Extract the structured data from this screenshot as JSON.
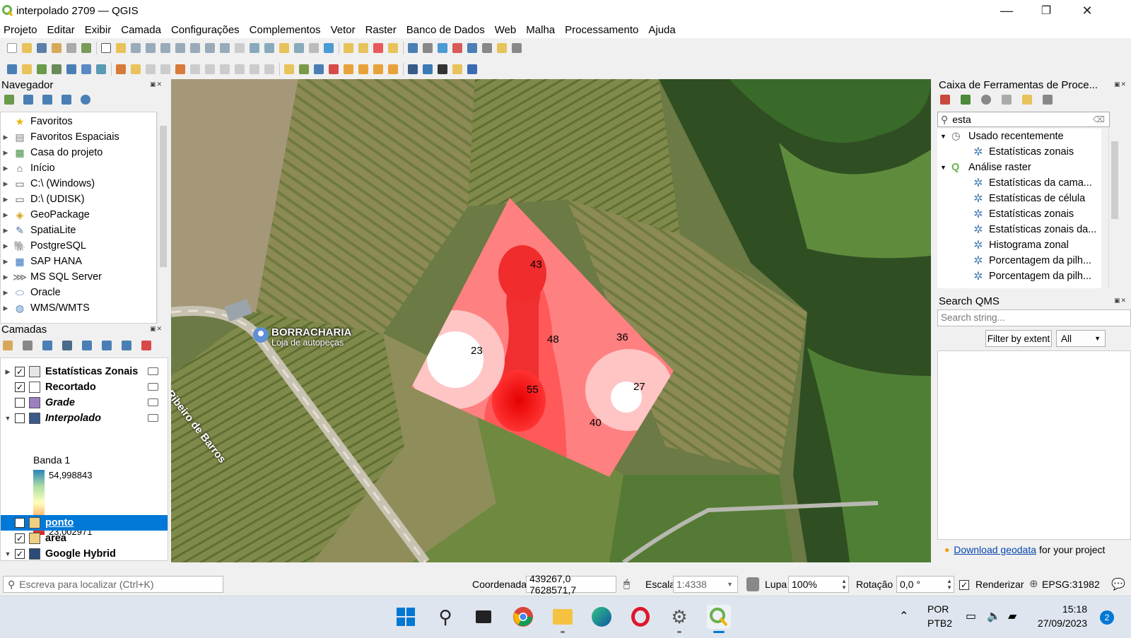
{
  "window": {
    "title": "interpolado 2709 — QGIS",
    "controls": {
      "minimize": "—",
      "restore": "❐",
      "close": "✕"
    }
  },
  "menubar": [
    "Projeto",
    "Editar",
    "Exibir",
    "Camada",
    "Configurações",
    "Complementos",
    "Vetor",
    "Raster",
    "Banco de Dados",
    "Web",
    "Malha",
    "Processamento",
    "Ajuda"
  ],
  "browser_panel": {
    "title": "Navegador",
    "items": [
      {
        "label": "Favoritos",
        "icon": "star-icon",
        "glyph": "★",
        "color": "#e8b400"
      },
      {
        "label": "Favoritos Espaciais",
        "icon": "spatial-bookmark-icon",
        "glyph": "▤",
        "color": "#777"
      },
      {
        "label": "Casa do projeto",
        "icon": "project-home-icon",
        "glyph": "▦",
        "color": "#3a8a3a"
      },
      {
        "label": "Início",
        "icon": "home-icon",
        "glyph": "⌂",
        "color": "#555"
      },
      {
        "label": "C:\\ (Windows)",
        "icon": "drive-icon",
        "glyph": "▭",
        "color": "#555"
      },
      {
        "label": "D:\\ (UDISK)",
        "icon": "drive-icon",
        "glyph": "▭",
        "color": "#555"
      },
      {
        "label": "GeoPackage",
        "icon": "geopackage-icon",
        "glyph": "◈",
        "color": "#d4a017"
      },
      {
        "label": "SpatiaLite",
        "icon": "spatialite-icon",
        "glyph": "✎",
        "color": "#4a6fa5"
      },
      {
        "label": "PostgreSQL",
        "icon": "postgresql-icon",
        "glyph": "🐘",
        "color": "#336791"
      },
      {
        "label": "SAP HANA",
        "icon": "sap-hana-icon",
        "glyph": "▦",
        "color": "#2a6ebb"
      },
      {
        "label": "MS SQL Server",
        "icon": "mssql-icon",
        "glyph": "⋙",
        "color": "#666"
      },
      {
        "label": "Oracle",
        "icon": "oracle-icon",
        "glyph": "⬭",
        "color": "#4a7fb5"
      },
      {
        "label": "WMS/WMTS",
        "icon": "wms-icon",
        "glyph": "◍",
        "color": "#4a7fb5"
      }
    ]
  },
  "layers_panel": {
    "title": "Camadas",
    "layers": [
      {
        "label": "Estatísticas Zonais",
        "checked": true,
        "bold": true,
        "italic": false,
        "expand": "▶",
        "icon": "polygon-layer-icon",
        "icolor": "#e5e5e5",
        "indicator": true
      },
      {
        "label": "Recortado",
        "checked": true,
        "bold": true,
        "italic": false,
        "expand": "",
        "icon": "polygon-outline-icon",
        "icolor": "#ffffff",
        "indicator": true
      },
      {
        "label": "Grade",
        "checked": false,
        "bold": true,
        "italic": true,
        "expand": "",
        "icon": "polygon-fill-icon",
        "icolor": "#9b7fc1",
        "indicator": true
      },
      {
        "label": "Interpolado",
        "checked": false,
        "bold": true,
        "italic": true,
        "expand": "▼",
        "icon": "raster-layer-icon",
        "icolor": "#3a5a8a",
        "indicator": true
      }
    ],
    "legend": {
      "band": "Banda 1",
      "max": "54,998843",
      "min": "23,002971"
    },
    "layers_bottom": [
      {
        "label": "ponto",
        "checked": true,
        "selected": true,
        "expand": "",
        "icon": "point-layer-icon"
      },
      {
        "label": "area",
        "checked": true,
        "selected": false,
        "expand": "",
        "icon": "polygon-edit-icon"
      },
      {
        "label": "Google Hybrid",
        "checked": true,
        "selected": false,
        "expand": "▼",
        "icon": "xyz-tile-icon"
      }
    ]
  },
  "map": {
    "poi": {
      "name": "BORRACHARIA",
      "sub": "Loja de autopeças"
    },
    "road_name": "ão Ribeiro de Barros",
    "point_labels": [
      {
        "text": "43"
      },
      {
        "text": "48"
      },
      {
        "text": "36"
      },
      {
        "text": "23"
      },
      {
        "text": "55"
      },
      {
        "text": "27"
      },
      {
        "text": "40"
      }
    ]
  },
  "processing_panel": {
    "title": "Caixa de Ferramentas de Proce...",
    "search_value": "esta",
    "groups": [
      {
        "label": "Usado recentemente",
        "icon": "clock-icon",
        "items": [
          "Estatísticas zonais"
        ]
      },
      {
        "label": "Análise raster",
        "icon": "qgis-icon",
        "items": [
          "Estatísticas da cama...",
          "Estatísticas de célula",
          "Estatísticas zonais",
          "Estatísticas zonais da...",
          "Histograma zonal",
          "Porcentagem da pilh...",
          "Porcentagem da pilh..."
        ]
      }
    ]
  },
  "qms_panel": {
    "title": "Search QMS",
    "placeholder": "Search string...",
    "filter_button": "Filter by extent",
    "filter_select": "All",
    "footer_link": "Download geodata",
    "footer_text": "for your project"
  },
  "statusbar": {
    "locator_placeholder": "Escreva para localizar (Ctrl+K)",
    "coord_label": "Coordenada",
    "coord_value": "439267,0 7628571,7",
    "scale_label": "Escala",
    "scale_value": "1:4338",
    "magnifier_label": "Lupa",
    "magnifier_value": "100%",
    "rotation_label": "Rotação",
    "rotation_value": "0,0 °",
    "render_label": "Renderizar",
    "crs": "EPSG:31982"
  },
  "taskbar": {
    "lang": "POR",
    "layout": "PTB2",
    "time": "15:18",
    "date": "27/09/2023",
    "notifications": "2"
  },
  "colors": {
    "selection": "#0078d7",
    "interp_low": "#ffffff",
    "interp_high": "#e60000"
  }
}
